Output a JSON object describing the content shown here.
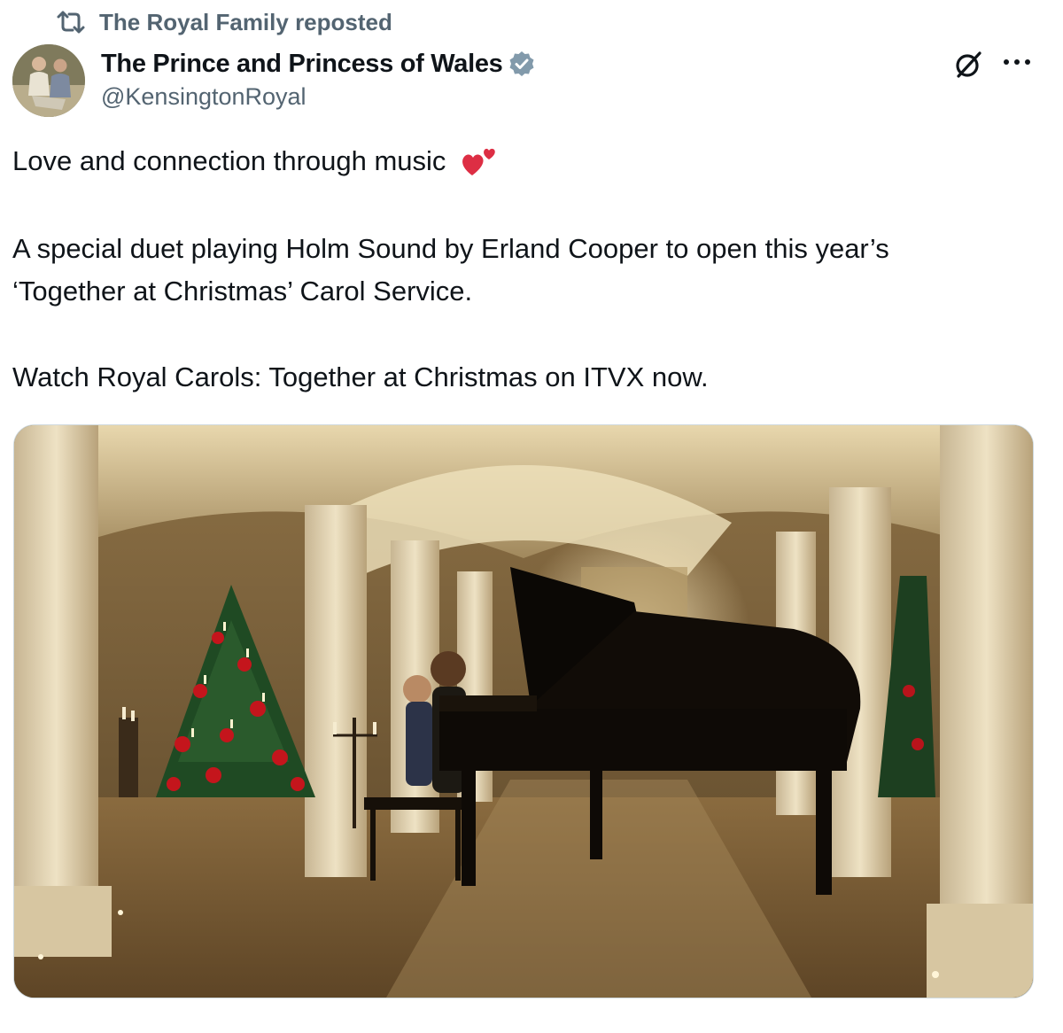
{
  "repost": {
    "label": "The Royal Family reposted",
    "icon": "repost-icon"
  },
  "author": {
    "display_name": "The Prince and Princess of Wales",
    "handle": "@KensingtonRoyal",
    "verified": true,
    "verified_color": "#829aab"
  },
  "actions": {
    "grok_icon": "grok-icon",
    "more_icon": "more-icon"
  },
  "tweet": {
    "line1": "Love and connection through music",
    "line1_emoji": "two-hearts-emoji",
    "para2_line1": "A special duet playing Holm Sound by Erland Cooper to open this year’s",
    "para2_line2": "‘Together at Christmas’ Carol Service.",
    "para3": "Watch Royal Carols: Together at Christmas on ITVX now."
  },
  "media": {
    "type": "photo",
    "subject": "grand-piano-duet-in-vaulted-hall"
  },
  "colors": {
    "text": "#0f1419",
    "secondary": "#536471",
    "heart": "#e0245e"
  }
}
